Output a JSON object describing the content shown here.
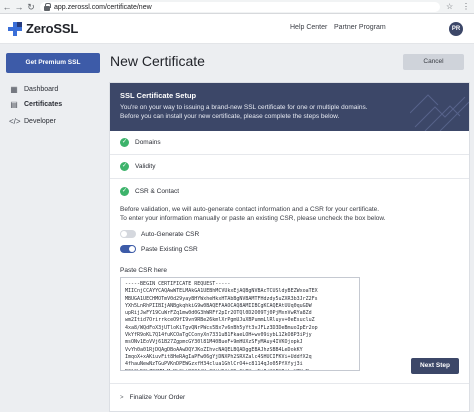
{
  "browser": {
    "url": "app.zerossl.com/certificate/new"
  },
  "header": {
    "logo_text": "ZeroSSL",
    "help_center": "Help Center",
    "partner_program": "Partner Program",
    "avatar_initials": "PR"
  },
  "sidebar": {
    "premium_label": "Get Premium SSL",
    "items": [
      {
        "label": "Dashboard",
        "icon": "dashboard-icon"
      },
      {
        "label": "Certificates",
        "icon": "certificate-icon"
      },
      {
        "label": "Developer",
        "icon": "code-icon"
      }
    ]
  },
  "main": {
    "title": "New Certificate",
    "cancel_label": "Cancel",
    "banner": {
      "title": "SSL Certificate Setup",
      "line1": "You're on your way to issuing a brand-new SSL certificate for one or multiple domains.",
      "line2": "Before you can install your new certificate, please complete the steps below."
    },
    "steps": [
      {
        "label": "Domains",
        "status": "complete"
      },
      {
        "label": "Validity",
        "status": "complete"
      },
      {
        "label": "CSR & Contact",
        "status": "complete"
      }
    ],
    "csr": {
      "desc1": "Before validation, we will auto-generate contact information and a CSR for your certificate.",
      "desc2": "To enter your information manually or paste an existing CSR, please uncheck the box below.",
      "auto_generate_label": "Auto-Generate CSR",
      "auto_generate_on": false,
      "paste_existing_label": "Paste Existing CSR",
      "paste_existing_on": true,
      "paste_label": "Paste CSR here",
      "csr_text": "-----BEGIN CERTIFICATE REQUEST-----\nMIICnjCCAYYCAQAwWTELMAkGA1UEBhMCVUkxEjAQBgNVBAcTCUSldyBEZWxoaTEX\nMBUGA1UECHMOTmV0d29yayBHYWxheHkxHTAbBgNVBAMTFHdzdy5uZXR3b3JrZ2Fs\nYXh5LnRhPIIBIjANBgkqhkiG9w0BAQEFAAOCAQ8AMIIBCgKCAQEAtUUq0quGDW\nupRijJwFY19CuWrFZq1mw0d0G3hWRFf2pIr2OTQl0D2O09Tj0PjMxnVwRYa8Zd\nwm2Itid7OrirrkceO9fI9vn9RBe26kmlXrPgmUJuXBPummLlRluyv+0eEsucluZ\n4xa8/WQdFoX3jUTloKiTgvQNrPWcs5Bx7v6nBh5yYt3vJFLz3D3DeBmuoIpEr2op\nVkYfR9oKL7Q14fuKCOaTgCConyXn7331uB1FkaeLOH+wv09iybL1ZkO8P3iPjy\nmsONv1EoVVj61B27ZgpmcGY30l81M40BueF+9mHUXzSFyMAuy4IVKOjopkJ\nVvYh0a01RjDQAgDBoAAwDQYJKoZIhvcNAQELBQADggEBAJhzSBB4LeDokKY\nImqoX+xAKiuvFit8HeRAgIaPFw06gYjDNXPh2SRXZalc4SHUCIFKVi+UddfX2q\n4fhauNewNzTGuPVKnDPEWGzxfH34clua1GhlCrO4+c8114qJo05PfXfyj3i\nR0lGhDGbZ9GMMvMwNLSbtN3OAfHa0XtW0ftSDoGhBYv+NjIjKAEUIikyVZVrM\n4pFodPIGFLZQZOd3PjjdJcqQ4Cm0xPtwVZfNJEFQ3Qp0kzNnRjkJnp8wX1Aq2\n-----END CERTIFICATE REQUEST-----",
      "next_label": "Next Step"
    },
    "finalize_label": "Finalize Your Order"
  },
  "colors": {
    "brand_blue": "#3d5ba8",
    "banner_navy": "#3c4768",
    "success_green": "#3db36b"
  }
}
